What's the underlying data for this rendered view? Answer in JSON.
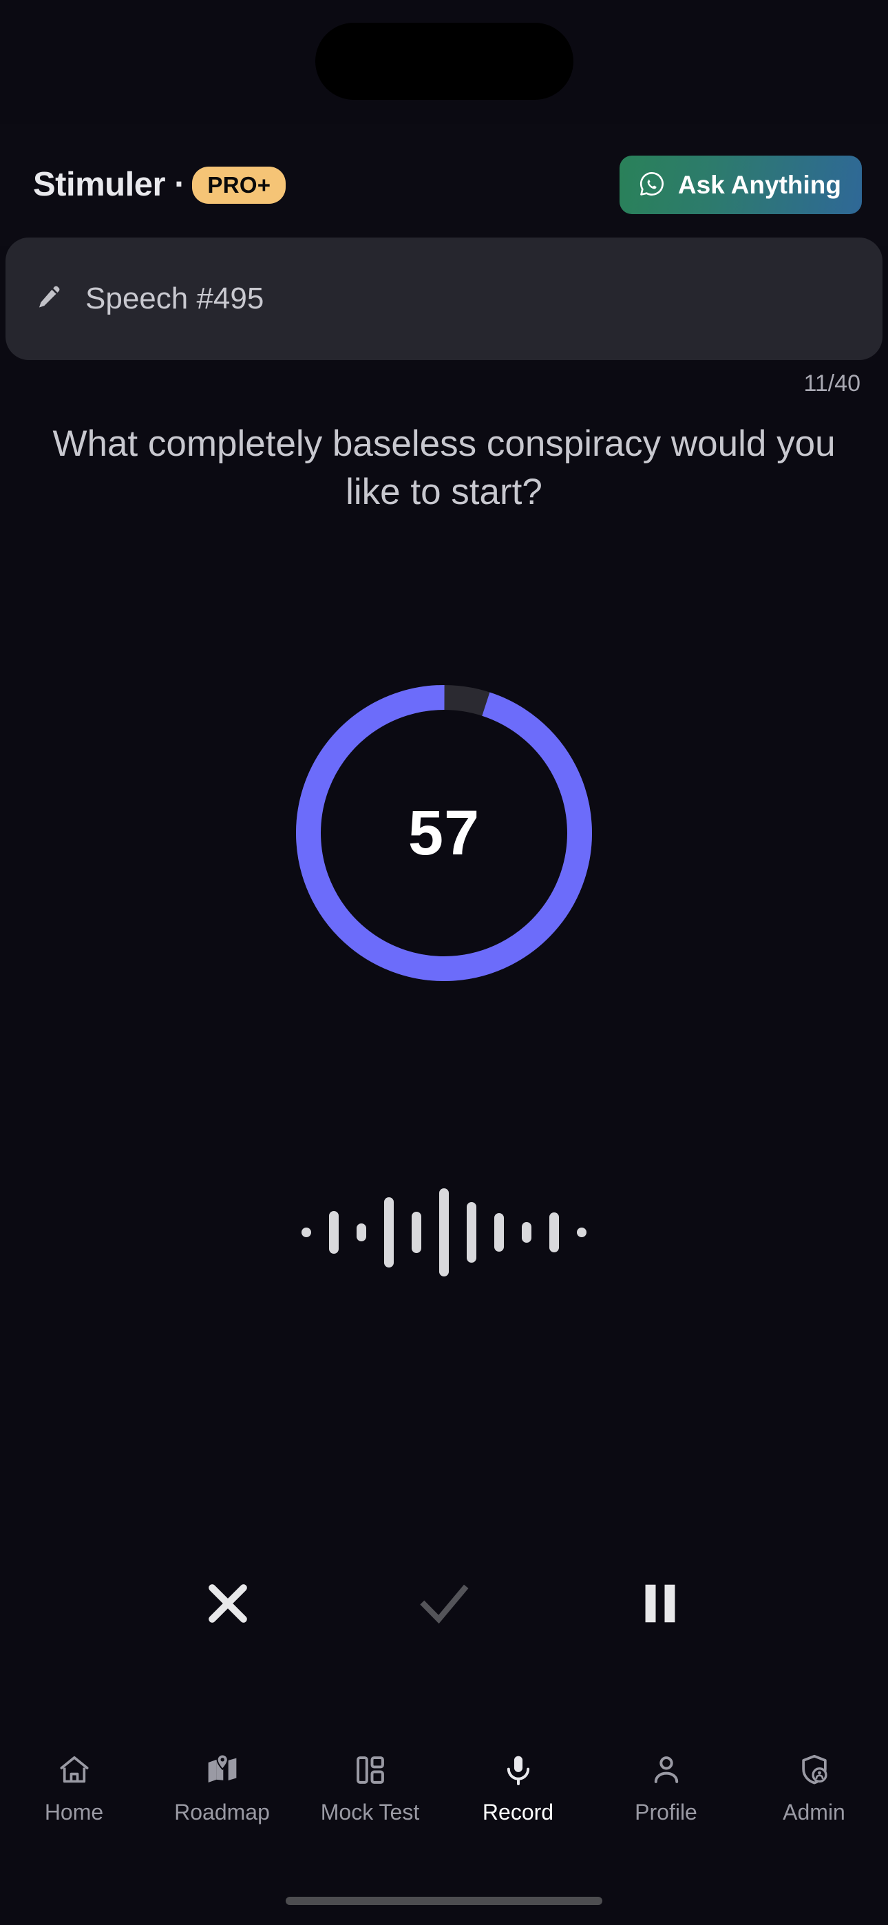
{
  "status_bar": {
    "dynamic_island": "dynamic-island"
  },
  "app_bar": {
    "brand_name": "Stimuler",
    "brand_separator": "·",
    "pro_badge": "PRO+",
    "ask_anything_label": "Ask Anything",
    "ask_icon": "whatsapp-icon",
    "gradient_start": "#2a8159",
    "gradient_end": "#2f6897",
    "badge_color": "#f5c476"
  },
  "speech_card": {
    "title": "Speech #495",
    "icon": "pencil-edit-icon",
    "background": "#26262e"
  },
  "question": {
    "counter": "11/40",
    "current": 11,
    "total": 40,
    "prompt": "What completely baseless conspiracy would you like to start?"
  },
  "timer": {
    "value": "57",
    "remaining_seconds": 57,
    "total_seconds": 60,
    "progress_percent": 95,
    "arc_color": "#6c6cfa",
    "track_color": "#2b2a31"
  },
  "waveform": {
    "color": "#d9d9dc",
    "bars": [
      14,
      62,
      26,
      102,
      60,
      128,
      88,
      56,
      30,
      58,
      14
    ]
  },
  "record_controls": [
    {
      "name": "cancel-button",
      "icon": "close-x-icon",
      "color": "#e8e8ea",
      "enabled": true
    },
    {
      "name": "submit-button",
      "icon": "check-icon",
      "color": "#545459",
      "enabled": false
    },
    {
      "name": "pause-button",
      "icon": "pause-icon",
      "color": "#e8e8ea",
      "enabled": true
    }
  ],
  "bottom_nav": {
    "active": "Record",
    "inactive_color": "#9a9aa4",
    "active_color": "#ffffff",
    "items": [
      {
        "label": "Home",
        "icon": "home-icon"
      },
      {
        "label": "Roadmap",
        "icon": "map-pin-icon"
      },
      {
        "label": "Mock Test",
        "icon": "dashboard-icon"
      },
      {
        "label": "Record",
        "icon": "microphone-icon"
      },
      {
        "label": "Profile",
        "icon": "person-icon"
      },
      {
        "label": "Admin",
        "icon": "shield-user-icon"
      }
    ]
  },
  "home_indicator": {
    "color": "#4d4d50"
  }
}
